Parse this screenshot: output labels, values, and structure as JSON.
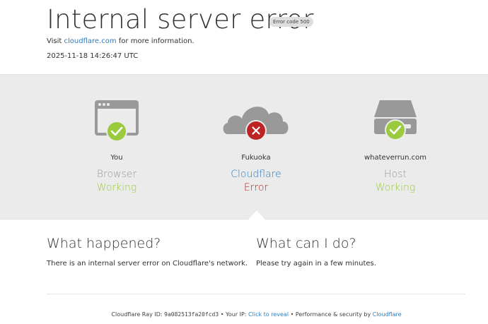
{
  "header": {
    "title": "Internal server error",
    "error_badge": "Error code 500",
    "visit_prefix": "Visit",
    "visit_link": "cloudflare.com",
    "visit_suffix": "for more information.",
    "timestamp": "2025-11-18 14:26:47 UTC"
  },
  "status_band": {
    "columns": [
      {
        "location": "You",
        "kind": "Browser",
        "status": "Working",
        "icon": "browser-icon",
        "badge_icon": "check-icon",
        "state": "ok"
      },
      {
        "location": "Fukuoka",
        "kind": "Cloudflare",
        "status": "Error",
        "icon": "cloud-icon",
        "badge_icon": "x-icon",
        "state": "error"
      },
      {
        "location": "whateverrun.com",
        "kind": "Host",
        "status": "Working",
        "icon": "server-icon",
        "badge_icon": "check-icon",
        "state": "ok"
      }
    ]
  },
  "what_happened": {
    "heading": "What happened?",
    "body": "There is an internal server error on Cloudflare's network."
  },
  "what_can_i_do": {
    "heading": "What can I do?",
    "body": "Please try again in a few minutes."
  },
  "footer": {
    "ray_label": "Cloudflare Ray ID:",
    "ray_id": "9a082513fa20fcd3",
    "sep1": "•",
    "ip_label": "Your IP:",
    "ip_link": "Click to reveal",
    "sep2": "•",
    "perf_label": "Performance & security by",
    "perf_link": "Cloudflare"
  },
  "colors": {
    "ok": "#9bca3e",
    "error": "#bd2426",
    "link": "#2f7bbf",
    "icon_gray": "#999999",
    "band": "#ebebeb"
  }
}
